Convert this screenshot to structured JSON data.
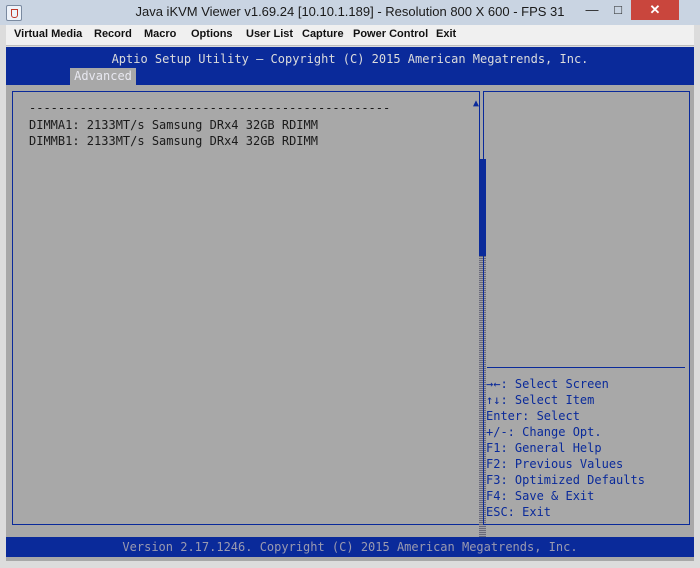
{
  "window": {
    "title": "Java iKVM Viewer v1.69.24 [10.10.1.189]  - Resolution 800 X 600 - FPS 31",
    "minimize_glyph": "—",
    "maximize_glyph": "□",
    "close_glyph": "✕"
  },
  "menu": {
    "virtual_media": "Virtual Media",
    "record": "Record",
    "macro": "Macro",
    "options": "Options",
    "user_list": "User List",
    "capture": "Capture",
    "power_control": "Power Control",
    "exit": "Exit"
  },
  "bios": {
    "header_title": "Aptio Setup Utility – Copyright (C) 2015 American Megatrends, Inc.",
    "active_tab": "Advanced",
    "separator": "--------------------------------------------------",
    "dimm_entries": [
      "DIMMA1: 2133MT/s Samsung DRx4 32GB RDIMM",
      "DIMMB1: 2133MT/s Samsung DRx4 32GB RDIMM"
    ],
    "scroll_up": "▲",
    "scroll_down": "▼",
    "help": [
      "→←: Select Screen",
      "↑↓: Select Item",
      "Enter: Select",
      "+/-: Change Opt.",
      "F1: General Help",
      "F2: Previous Values",
      "F3: Optimized Defaults",
      "F4: Save & Exit",
      "ESC: Exit"
    ],
    "footer": "Version 2.17.1246. Copyright (C) 2015 American Megatrends, Inc."
  },
  "colors": {
    "bios_blue": "#0a2a9a",
    "bios_gray": "#a8a8a8",
    "close_red": "#c9463d"
  }
}
